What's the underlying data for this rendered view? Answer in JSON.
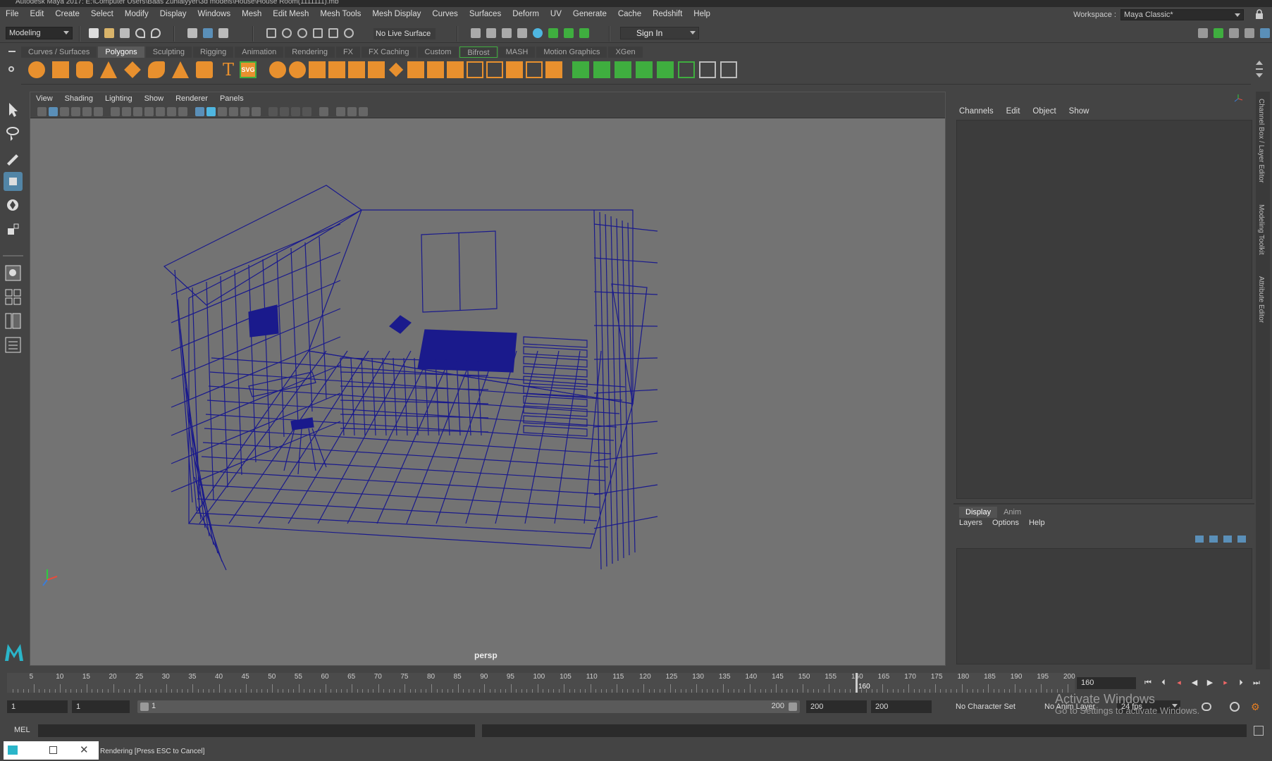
{
  "window": {
    "title": "Autodesk Maya 2017: E:\\Computer Users\\Baas Zuhlaiyyer\\3d models\\House\\House Room(1111111).mb"
  },
  "menubar": {
    "items": [
      "File",
      "Edit",
      "Create",
      "Select",
      "Modify",
      "Display",
      "Windows",
      "Mesh",
      "Edit Mesh",
      "Mesh Tools",
      "Mesh Display",
      "Curves",
      "Surfaces",
      "Deform",
      "UV",
      "Generate",
      "Cache",
      "Redshift",
      "Help"
    ]
  },
  "workspace": {
    "label": "Workspace :",
    "value": "Maya Classic*"
  },
  "statusline": {
    "mode": "Modeling",
    "live_surface": "No Live Surface",
    "sign_in": "Sign In"
  },
  "shelf": {
    "tabs": [
      "Curves / Surfaces",
      "Polygons",
      "Sculpting",
      "Rigging",
      "Animation",
      "Rendering",
      "FX",
      "FX Caching",
      "Custom",
      "Bifrost",
      "MASH",
      "Motion Graphics",
      "XGen"
    ],
    "active_tab": "Polygons",
    "text_icon": "T",
    "svg_icon": "SVG"
  },
  "viewport": {
    "menus": [
      "View",
      "Shading",
      "Lighting",
      "Show",
      "Renderer",
      "Panels"
    ],
    "camera_label": "persp",
    "wire_color": "#1a1a8c"
  },
  "channelbox": {
    "menus": [
      "Channels",
      "Edit",
      "Object",
      "Show"
    ]
  },
  "layereditor": {
    "tabs": [
      "Display",
      "Anim"
    ],
    "menus": [
      "Layers",
      "Options",
      "Help"
    ]
  },
  "sidetabs": [
    "Channel Box / Layer Editor",
    "Modeling Toolkit",
    "Attribute Editor"
  ],
  "timeslider": {
    "ticks": [
      "5",
      "10",
      "15",
      "20",
      "25",
      "30",
      "35",
      "40",
      "45",
      "50",
      "55",
      "60",
      "65",
      "70",
      "75",
      "80",
      "85",
      "90",
      "95",
      "100",
      "105",
      "110",
      "115",
      "120",
      "125",
      "130",
      "135",
      "140",
      "145",
      "150",
      "155",
      "160",
      "165",
      "170",
      "175",
      "180",
      "185",
      "190",
      "195",
      "200"
    ],
    "current_marker": "160",
    "current_frame": "160"
  },
  "rangeslider": {
    "start": "1",
    "playback_start": "1",
    "range_start": "1",
    "range_end": "200",
    "playback_end": "200",
    "end": "200",
    "character_set": "No Character Set",
    "anim_layer": "No Anim Layer",
    "fps": "24 fps"
  },
  "cmdline": {
    "label": "MEL"
  },
  "helpline": {
    "text": "Rendering [Press ESC to Cancel]"
  },
  "watermark": {
    "line1": "Activate Windows",
    "line2": "Go to Settings to activate Windows."
  }
}
